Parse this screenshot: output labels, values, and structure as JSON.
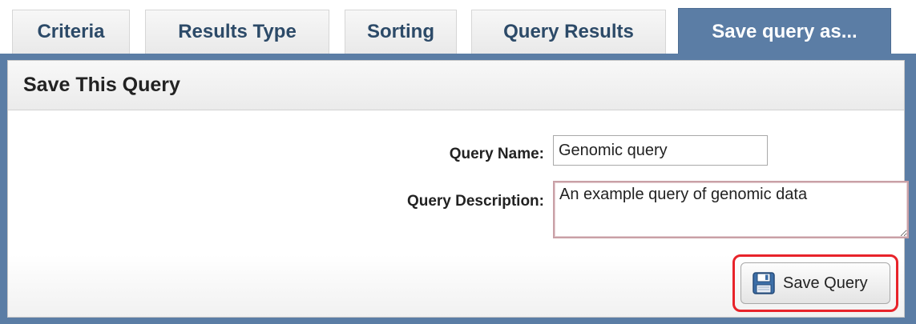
{
  "tabs": [
    {
      "label": "Criteria",
      "active": false
    },
    {
      "label": "Results Type",
      "active": false
    },
    {
      "label": "Sorting",
      "active": false
    },
    {
      "label": "Query Results",
      "active": false
    },
    {
      "label": "Save query as...",
      "active": true
    }
  ],
  "panel": {
    "title": "Save This Query"
  },
  "form": {
    "name_label": "Query Name:",
    "name_value": "Genomic query",
    "description_label": "Query Description:",
    "description_value": "An example query of genomic data"
  },
  "actions": {
    "save_label": "Save Query",
    "save_icon": "floppy-disk-icon"
  },
  "colors": {
    "accent": "#5b7da5",
    "highlight": "#e8232a"
  }
}
